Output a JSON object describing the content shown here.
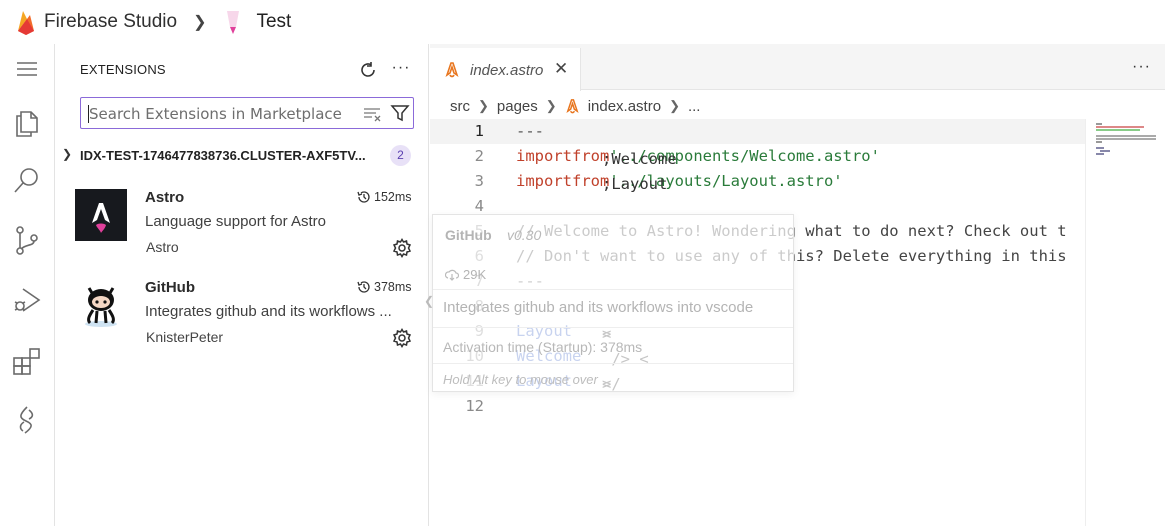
{
  "app": {
    "brand_name": "Firebase Studio",
    "project_name": "Test"
  },
  "activity_bar": {
    "items": [
      "menu-icon",
      "explorer-icon",
      "search-icon",
      "source-control-icon",
      "run-debug-icon",
      "extensions-icon",
      "firebase-studio-icon"
    ]
  },
  "sidebar": {
    "title": "EXTENSIONS",
    "search_placeholder": "Search Extensions in Marketplace",
    "group": {
      "name": "IDX-TEST-1746477838736.CLUSTER-AXF5TV...",
      "count": "2"
    },
    "extensions": [
      {
        "name": "Astro",
        "time": "152ms",
        "description": "Language support for Astro",
        "publisher": "Astro"
      },
      {
        "name": "GitHub",
        "time": "378ms",
        "description": "Integrates github and its workflows ...",
        "publisher": "KnisterPeter"
      }
    ]
  },
  "editor": {
    "tab_label": "index.astro",
    "breadcrumbs": [
      "src",
      "pages",
      "index.astro",
      "..."
    ],
    "current_line": 1,
    "lines": [
      {
        "n": "1",
        "tokens": [
          [
            "punct",
            "---"
          ]
        ]
      },
      {
        "n": "2",
        "tokens": [
          [
            "kw",
            "import"
          ],
          [
            "txt",
            " Welcome "
          ],
          [
            "kw",
            "from"
          ],
          [
            "txt",
            " "
          ],
          [
            "str",
            "'../components/Welcome.astro'"
          ],
          [
            "txt",
            ";"
          ]
        ]
      },
      {
        "n": "3",
        "tokens": [
          [
            "kw",
            "import"
          ],
          [
            "txt",
            " Layout "
          ],
          [
            "kw",
            "from"
          ],
          [
            "txt",
            " "
          ],
          [
            "str",
            "'../layouts/Layout.astro'"
          ],
          [
            "txt",
            ";"
          ]
        ]
      },
      {
        "n": "4",
        "tokens": []
      },
      {
        "n": "5",
        "tokens": [
          [
            "cmt",
            "// Welcome to Astro! Wondering what to do next? Check out t"
          ]
        ]
      },
      {
        "n": "6",
        "tokens": [
          [
            "cmt",
            "// Don't want to use any of this? Delete everything in this"
          ]
        ]
      },
      {
        "n": "7",
        "tokens": [
          [
            "punct",
            "---"
          ]
        ]
      },
      {
        "n": "8",
        "tokens": []
      },
      {
        "n": "9",
        "tokens": [
          [
            "txt",
            "<"
          ],
          [
            "tag",
            "Layout"
          ],
          [
            "txt",
            ">"
          ]
        ]
      },
      {
        "n": "10",
        "tokens": [
          [
            "txt",
            "    <"
          ],
          [
            "tag",
            "Welcome"
          ],
          [
            "txt",
            " />"
          ]
        ]
      },
      {
        "n": "11",
        "tokens": [
          [
            "txt",
            "</"
          ],
          [
            "tag",
            "Layout"
          ],
          [
            "txt",
            ">"
          ]
        ]
      },
      {
        "n": "12",
        "tokens": []
      }
    ]
  },
  "hover_card": {
    "title": "GitHub",
    "version": "v0.30",
    "downloads": "29K",
    "description": "Integrates github and its workflows into vscode",
    "activation": "Activation time (Startup): 378ms",
    "hint": "Hold Alt key to mouse over"
  },
  "colors": {
    "accent": "#8b6ad9",
    "keyword": "#c0412b",
    "string": "#2a7b3a",
    "tag": "#3b63c7",
    "badge_bg": "#e8e1f7"
  }
}
